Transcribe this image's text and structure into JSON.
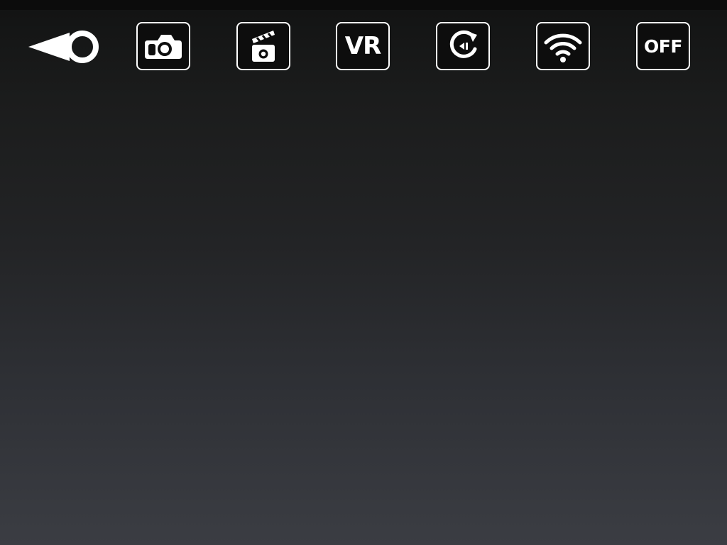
{
  "toolbar": {
    "buttons": [
      {
        "id": "back",
        "icon": "back-icon"
      },
      {
        "id": "camera",
        "icon": "camera-icon"
      },
      {
        "id": "video",
        "icon": "video-clapper-icon"
      },
      {
        "id": "vr",
        "icon": "vr-icon",
        "label": "VR"
      },
      {
        "id": "rotate",
        "icon": "rotate-icon"
      },
      {
        "id": "wifi",
        "icon": "wifi-icon"
      },
      {
        "id": "off",
        "icon": "power-off-icon",
        "label": "OFF"
      }
    ]
  },
  "colors": {
    "icon": "#ffffff",
    "button_fill": "#0d0d0d",
    "background_top": "#121313",
    "background_bottom": "#3b3d43"
  }
}
